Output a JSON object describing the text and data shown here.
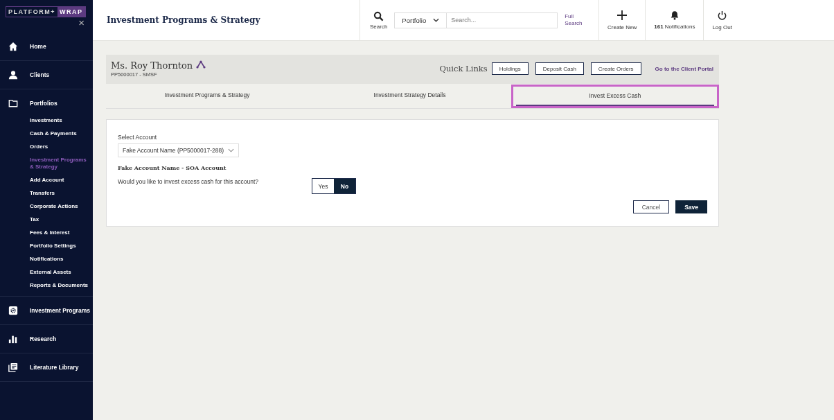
{
  "sidebar": {
    "logo": {
      "left": "PLATFORM+",
      "right": "WRAP"
    },
    "close": "×",
    "sections": [
      {
        "label": "Home"
      },
      {
        "label": "Clients"
      },
      {
        "label": "Portfolios",
        "children": [
          {
            "label": "Investments",
            "selected": false
          },
          {
            "label": "Cash & Payments",
            "selected": false
          },
          {
            "label": "Orders",
            "selected": false
          },
          {
            "label": "Investment Programs & Strategy",
            "selected": true
          },
          {
            "label": "Add Account",
            "selected": false
          },
          {
            "label": "Transfers",
            "selected": false
          },
          {
            "label": "Corporate Actions",
            "selected": false
          },
          {
            "label": "Tax",
            "selected": false
          },
          {
            "label": "Fees & Interest",
            "selected": false
          },
          {
            "label": "Portfolio Settings",
            "selected": false
          },
          {
            "label": "Notifications",
            "selected": false
          },
          {
            "label": "External Assets",
            "selected": false
          },
          {
            "label": "Reports & Documents",
            "selected": false
          }
        ]
      },
      {
        "label": "Investment Programs"
      },
      {
        "label": "Research"
      },
      {
        "label": "Literature Library"
      }
    ]
  },
  "header": {
    "title": "Investment Programs & Strategy",
    "search_label": "Search",
    "scope": "Portfolio",
    "search_placeholder": "Search...",
    "full_search": "Full Search",
    "actions": [
      {
        "label": "Create New"
      },
      {
        "label": "**161** Notifications"
      },
      {
        "label": "Log Out"
      }
    ]
  },
  "client": {
    "name": "Ms. Roy Thornton",
    "id": "PP5000017 - SMSF",
    "quick_links_title": "Quick Links",
    "quick_links": [
      "Holdings",
      "Deposit Cash",
      "Create Orders"
    ],
    "portal_link": "Go to the Client Portal"
  },
  "tabs": [
    {
      "label": "Investment Programs & Strategy",
      "selected": false,
      "highlighted": false
    },
    {
      "label": "Investment Strategy Details",
      "selected": false,
      "highlighted": false
    },
    {
      "label": "Invest Excess Cash",
      "selected": true,
      "highlighted": true
    }
  ],
  "form": {
    "account_label": "Select Account",
    "account_value": "Fake Account Name (PP5000017-288)",
    "account_heading": "Fake Account Name - SOA Account",
    "question": "Would you like to invest excess cash for this account?",
    "options": [
      {
        "label": "Yes",
        "selected": false
      },
      {
        "label": "No",
        "selected": true
      }
    ],
    "buttons": [
      {
        "label": "Cancel",
        "kind": "secondary"
      },
      {
        "label": "Save",
        "kind": "primary"
      }
    ]
  }
}
